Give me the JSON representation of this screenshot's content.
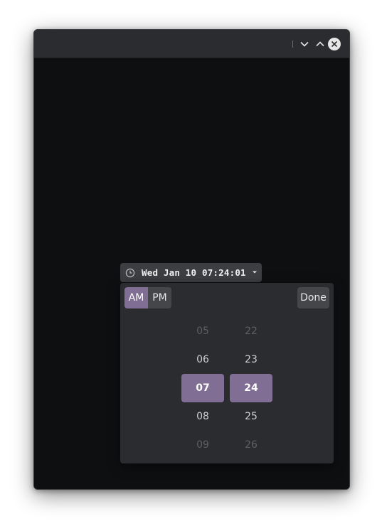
{
  "window": {
    "controls": [
      {
        "name": "minimize",
        "icon": "chevron-down-icon"
      },
      {
        "name": "maximize",
        "icon": "chevron-up-icon"
      },
      {
        "name": "close",
        "icon": "close-icon"
      }
    ]
  },
  "time_button": {
    "icon": "clock-icon",
    "text": "Wed Jan 10 07:24:01",
    "caret": "dropdown-caret-icon"
  },
  "picker": {
    "am_label": "AM",
    "pm_label": "PM",
    "selected_period": "AM",
    "done_label": "Done",
    "hours": [
      "05",
      "06",
      "07",
      "08",
      "09"
    ],
    "minutes": [
      "22",
      "23",
      "24",
      "25",
      "26"
    ],
    "selected_hour": "07",
    "selected_minute": "24"
  },
  "colors": {
    "accent": "#806e95",
    "window_bg": "#0e0f11",
    "titlebar_bg": "#2b2c30",
    "popover_bg": "#2b2c2f",
    "button_bg": "#45464a"
  }
}
